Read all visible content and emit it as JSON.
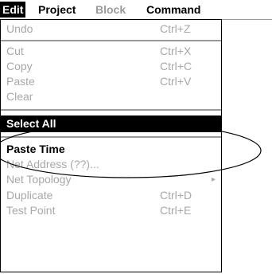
{
  "menubar": {
    "items": [
      {
        "label": "Edit",
        "state": "active"
      },
      {
        "label": "Project",
        "state": "enabled"
      },
      {
        "label": "Block",
        "state": "disabled"
      },
      {
        "label": "Command",
        "state": "enabled"
      }
    ]
  },
  "menu": {
    "groups": [
      [
        {
          "label": "Undo",
          "shortcut": "Ctrl+Z",
          "state": "disabled"
        }
      ],
      [
        {
          "label": "Cut",
          "shortcut": "Ctrl+X",
          "state": "disabled"
        },
        {
          "label": "Copy",
          "shortcut": "Ctrl+C",
          "state": "disabled"
        },
        {
          "label": "Paste",
          "shortcut": "Ctrl+V",
          "state": "disabled"
        },
        {
          "label": "Clear",
          "shortcut": "",
          "state": "disabled"
        }
      ],
      [
        {
          "label": "Select All",
          "shortcut": "",
          "state": "highlighted"
        }
      ],
      [
        {
          "label": "Paste Time",
          "shortcut": "",
          "state": "bold"
        },
        {
          "label": "Net Address (??)...",
          "shortcut": "",
          "state": "disabled"
        },
        {
          "label": "Net Topology",
          "shortcut": "",
          "state": "disabled",
          "submenu": true
        },
        {
          "label": "Duplicate",
          "shortcut": "Ctrl+D",
          "state": "disabled"
        },
        {
          "label": "Test Point",
          "shortcut": "Ctrl+E",
          "state": "disabled"
        }
      ]
    ]
  },
  "icons": {
    "submenu_arrow": "▸"
  },
  "colors": {
    "highlight_bg": "#000000",
    "disabled_text": "#a8a8a8",
    "separator": "#9a9a9a"
  }
}
